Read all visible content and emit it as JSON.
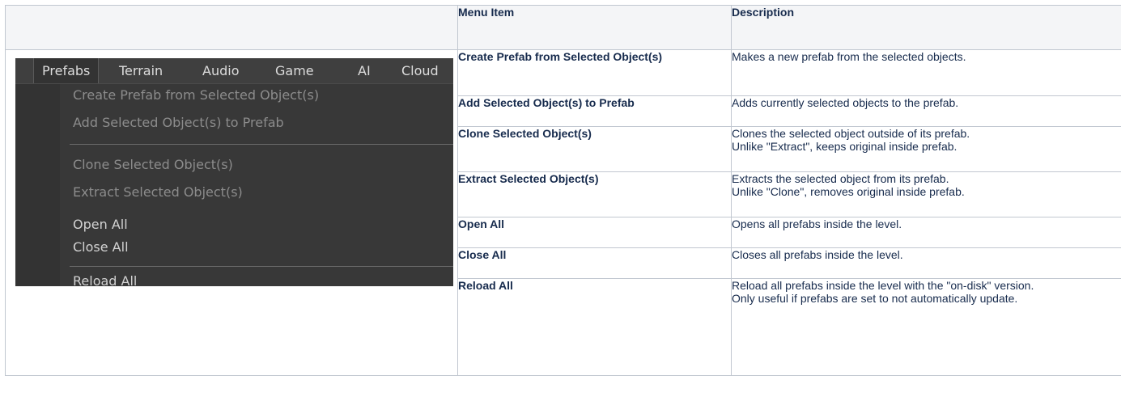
{
  "table": {
    "headers": {
      "menu_item": "Menu Item",
      "description": "Description"
    },
    "rows": [
      {
        "item": "Create Prefab from Selected Object(s)",
        "description": [
          "Makes a new prefab from the selected objects."
        ]
      },
      {
        "item": "Add Selected Object(s) to Prefab",
        "description": [
          "Adds currently selected objects to the prefab."
        ]
      },
      {
        "item": "Clone Selected Object(s)",
        "description": [
          "Clones the selected object outside of its prefab.",
          "Unlike \"Extract\", keeps original inside prefab."
        ]
      },
      {
        "item": "Extract Selected Object(s)",
        "description": [
          "Extracts the selected object from its prefab.",
          "Unlike \"Clone\", removes original inside prefab."
        ]
      },
      {
        "item": "Open All",
        "description": [
          "Opens all prefabs inside the level."
        ]
      },
      {
        "item": "Close All",
        "description": [
          "Closes all prefabs inside the level."
        ]
      },
      {
        "item": "Reload All",
        "description": [
          "Reload all prefabs inside the level with the \"on-disk\" version.",
          "Only useful if prefabs are set to not automatically update."
        ]
      }
    ]
  },
  "menu_screenshot": {
    "menubar": [
      "Prefabs",
      "Terrain",
      "Audio",
      "Game",
      "AI",
      "Cloud"
    ],
    "active_menu": "Prefabs",
    "items": [
      {
        "label": "Create Prefab from Selected Object(s)",
        "enabled": false
      },
      {
        "label": "Add Selected Object(s) to Prefab",
        "enabled": false
      },
      {
        "label": "Clone Selected Object(s)",
        "enabled": false
      },
      {
        "label": "Extract Selected Object(s)",
        "enabled": false
      },
      {
        "label": "Open All",
        "enabled": true
      },
      {
        "label": "Close All",
        "enabled": true
      },
      {
        "label": "Reload All",
        "enabled": true
      }
    ],
    "colors": {
      "background": "#3b3b3b",
      "enabled_text": "#d2d2d2",
      "disabled_text": "#8c8c8c"
    }
  }
}
